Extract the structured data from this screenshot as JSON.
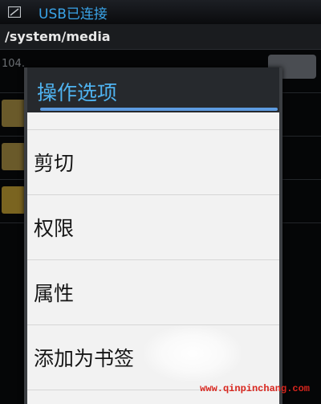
{
  "status_bar": {
    "text": "USB已连接",
    "icon": "usb-icon"
  },
  "path_bar": {
    "path": "/system/media"
  },
  "background": {
    "first_row_info": "104."
  },
  "dialog": {
    "title": "操作选项",
    "items": [
      {
        "label": "剪切"
      },
      {
        "label": "权限"
      },
      {
        "label": "属性"
      },
      {
        "label": "添加为书签"
      }
    ]
  },
  "watermark": {
    "text": "www.qinpinchang.com"
  },
  "colors": {
    "status_text": "#3aa4e8",
    "dialog_title": "#4fb3f0",
    "title_underline": "#5d9be0",
    "watermark": "#d8251d"
  }
}
